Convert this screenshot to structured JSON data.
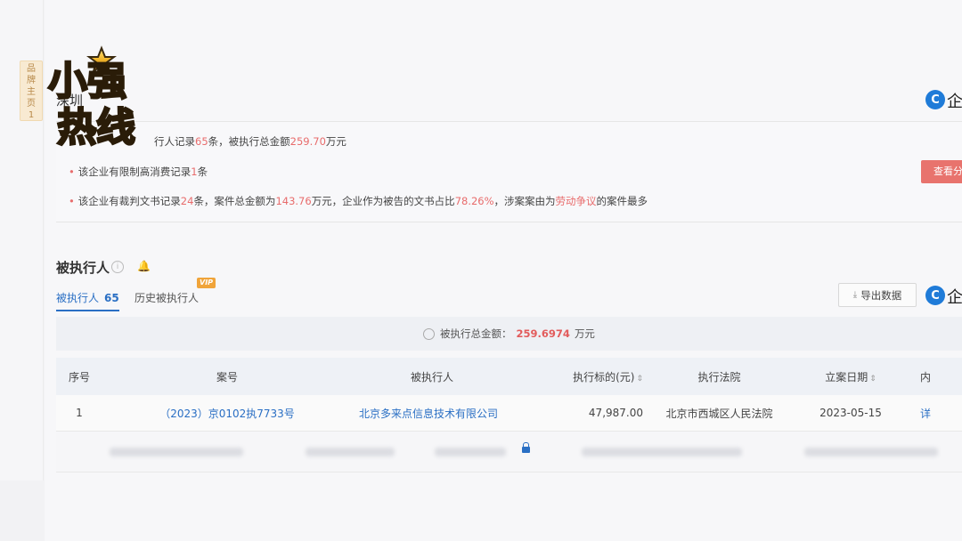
{
  "brand_tab": {
    "lines": [
      "品",
      "牌",
      "主",
      "页",
      "1"
    ]
  },
  "company": {
    "title_prefix": "深圳"
  },
  "qcc": {
    "logo_letter": "C",
    "text": "企"
  },
  "risk_summary": {
    "line1": {
      "pre": "行人记录",
      "count": "65",
      "mid": "条，被执行总金额",
      "amount": "259.70",
      "post": "万元"
    },
    "line2": {
      "pre": "该企业有限制高消费记录",
      "count": "1",
      "post": "条"
    },
    "line3": {
      "pre": "该企业有裁判文书记录",
      "count": "24",
      "mid1": "条，案件总金额为",
      "amount": "143.76",
      "mid2": "万元，企业作为被告的文书占比",
      "ratio": "78.26%",
      "mid3": "，涉案案由为",
      "cause": "劳动争议",
      "post": "的案件最多"
    },
    "view_button": "查看分"
  },
  "section": {
    "title": "被执行人",
    "info_icon": "i"
  },
  "tabs": {
    "active_label": "被执行人",
    "active_count": "65",
    "history_label": "历史被执行人",
    "vip": "VIP"
  },
  "export_button": "导出数据",
  "total": {
    "label": "被执行总金额：",
    "amount": "259.6974",
    "unit": "万元"
  },
  "table": {
    "headers": {
      "no": "序号",
      "case": "案号",
      "party": "被执行人",
      "amount": "执行标的(元)",
      "court": "执行法院",
      "date": "立案日期",
      "more": "内"
    },
    "rows": [
      {
        "no": "1",
        "case": "（2023）京0102执7733号",
        "party": "北京多来点信息技术有限公司",
        "amount": "47,987.00",
        "court": "北京市西城区人民法院",
        "date": "2023-05-15",
        "more": "详"
      }
    ]
  },
  "logo_text": "小强热线"
}
